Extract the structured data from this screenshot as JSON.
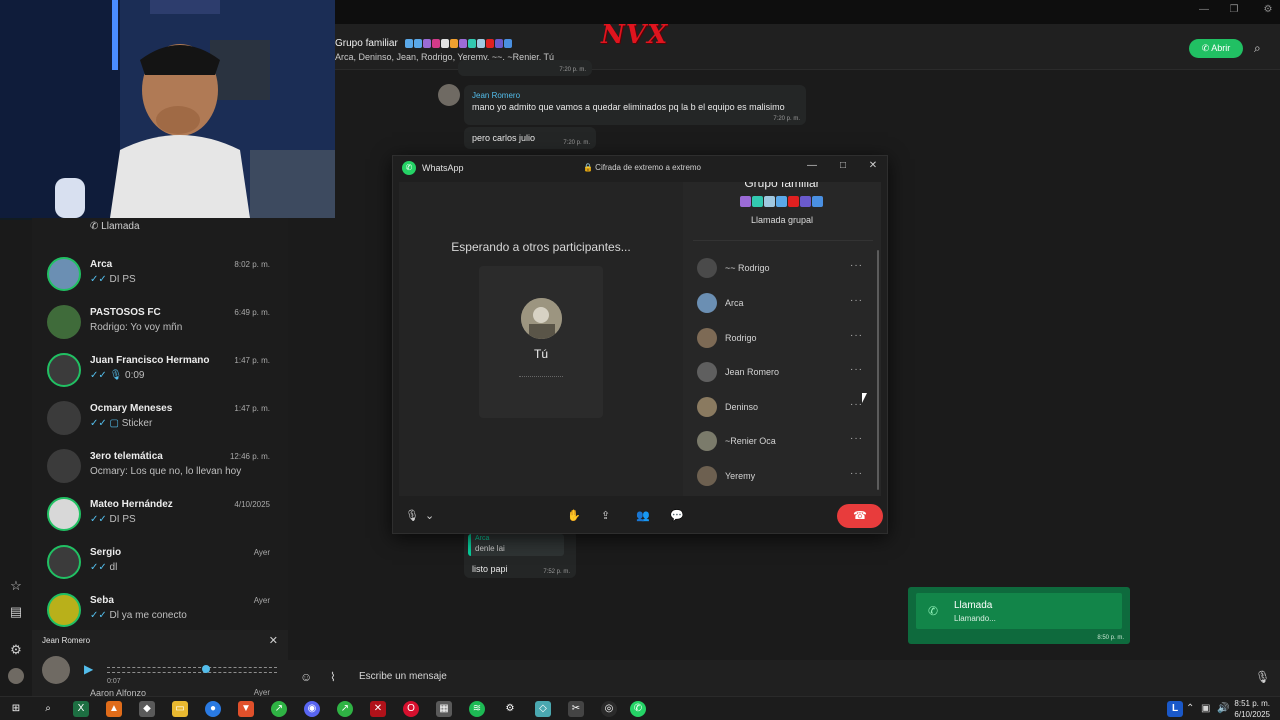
{
  "window": {
    "minimize_label": "—",
    "maximize_label": "❐",
    "close_label": "✕"
  },
  "logo": {
    "text": "NVX"
  },
  "header": {
    "group_name": "Grupo familiar",
    "members": "Arca, Deninso, Jean, Rodrigo, Yeremy, ~~, ~Renier, Tú",
    "open_button": "Abrir"
  },
  "chatlist": {
    "top_item": {
      "text": "Llamada"
    },
    "items": [
      {
        "name": "Arca",
        "message": "DI PS",
        "time": "8:02 p. m.",
        "ticks": "✓✓",
        "avatar_color": "#6b8fb3"
      },
      {
        "name": "PASTOSOS FC",
        "message": "Rodrigo: Yo voy mñn",
        "time": "6:49 p. m.",
        "ticks": "",
        "avatar_color": "#3f6b3a"
      },
      {
        "name": "Juan Francisco Hermano",
        "message": "0:09",
        "time": "1:47 p. m.",
        "ticks": "✓✓ 🎙",
        "avatar_color": "#3b3b3b"
      },
      {
        "name": "Ocmary Meneses",
        "message": "Sticker",
        "time": "1:47 p. m.",
        "ticks": "✓✓ ▢",
        "avatar_color": "#3b3b3b"
      },
      {
        "name": "3ero telemática",
        "message": "Ocmary: Los que no, lo llevan hoy",
        "time": "12:46 p. m.",
        "ticks": "",
        "avatar_color": "#3b3b3b"
      },
      {
        "name": "Mateo Hernández",
        "message": "DI PS",
        "time": "4/10/2025",
        "ticks": "✓✓",
        "avatar_color": "#d8d8d8"
      },
      {
        "name": "Sergio",
        "message": "dl",
        "time": "Ayer",
        "ticks": "✓✓",
        "avatar_color": "#3b3b3b"
      },
      {
        "name": "Seba",
        "message": "Dl ya me conecto",
        "time": "Ayer",
        "ticks": "✓✓",
        "avatar_color": "#b9b01a"
      }
    ]
  },
  "audio_player": {
    "title": "Jean Romero",
    "duration": "0:07",
    "close": "✕",
    "next_name": "Aaron Alfonzo",
    "next_time": "Ayer"
  },
  "messages": {
    "top_time": "7:20 p. m.",
    "jean": {
      "author": "Jean Romero",
      "text": "mano yo admito que vamos a quedar eliminados pq la b el equipo es malisimo",
      "time": "7:20 p. m."
    },
    "carlos": {
      "text": "pero carlos julio",
      "time": "7:20 p. m."
    },
    "reply": {
      "quote_author": "Arca",
      "quote_text": "denle lai",
      "text": "listo papi",
      "time": "7:52 p. m."
    }
  },
  "composer": {
    "placeholder": "Escribe un mensaje"
  },
  "notification": {
    "title": "Llamada",
    "subtitle": "Llamando...",
    "time": "8:50 p. m."
  },
  "call": {
    "app_name": "WhatsApp",
    "encryption": "🔒 Cifrada de extremo a extremo",
    "waiting": "Esperando a otros participantes...",
    "self_name": "Tú",
    "panel_title": "Grupo familiar",
    "panel_sub": "Llamada grupal",
    "participants": [
      {
        "name": "~~ Rodrigo",
        "color": "#4a4a4a"
      },
      {
        "name": "Arca",
        "color": "#6b8fb3"
      },
      {
        "name": "Rodrigo",
        "color": "#7d6a55"
      },
      {
        "name": "Jean Romero",
        "color": "#5f5f5f"
      },
      {
        "name": "Deninso",
        "color": "#8a7a60"
      },
      {
        "name": "~Renier Oca",
        "color": "#7b7b6b"
      },
      {
        "name": "Yeremy",
        "color": "#6d6050"
      }
    ],
    "more": "···"
  },
  "taskbar": {
    "time": "8:51 p. m.",
    "date": "6/10/2025",
    "lang": "L"
  },
  "colors": {
    "accent": "#21c063",
    "hangup": "#e83c3c",
    "link": "#53bdeb"
  }
}
